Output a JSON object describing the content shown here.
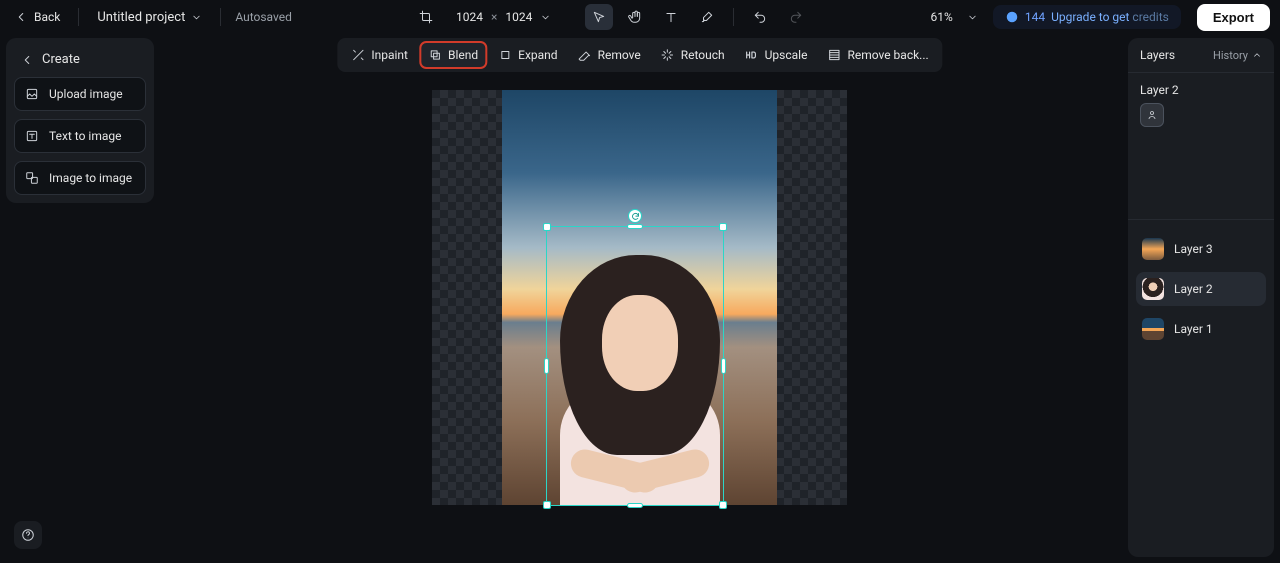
{
  "header": {
    "back": "Back",
    "project_name": "Untitled project",
    "autosaved": "Autosaved",
    "dimensions": {
      "w": "1024",
      "h": "1024"
    },
    "zoom": "61%",
    "credits": "144",
    "upgrade_text": "Upgrade to get ",
    "upgrade_credits": "credits",
    "export": "Export"
  },
  "left_panel": {
    "title": "Create",
    "items": [
      "Upload image",
      "Text to image",
      "Image to image"
    ]
  },
  "toolbar": {
    "items": [
      "Inpaint",
      "Blend",
      "Expand",
      "Remove",
      "Retouch",
      "Upscale",
      "Remove back..."
    ],
    "highlight_index": 1
  },
  "layers_panel": {
    "title": "Layers",
    "history": "History",
    "current_layer": "Layer 2",
    "layers": [
      "Layer 3",
      "Layer 2",
      "Layer 1"
    ],
    "active_index": 1
  }
}
